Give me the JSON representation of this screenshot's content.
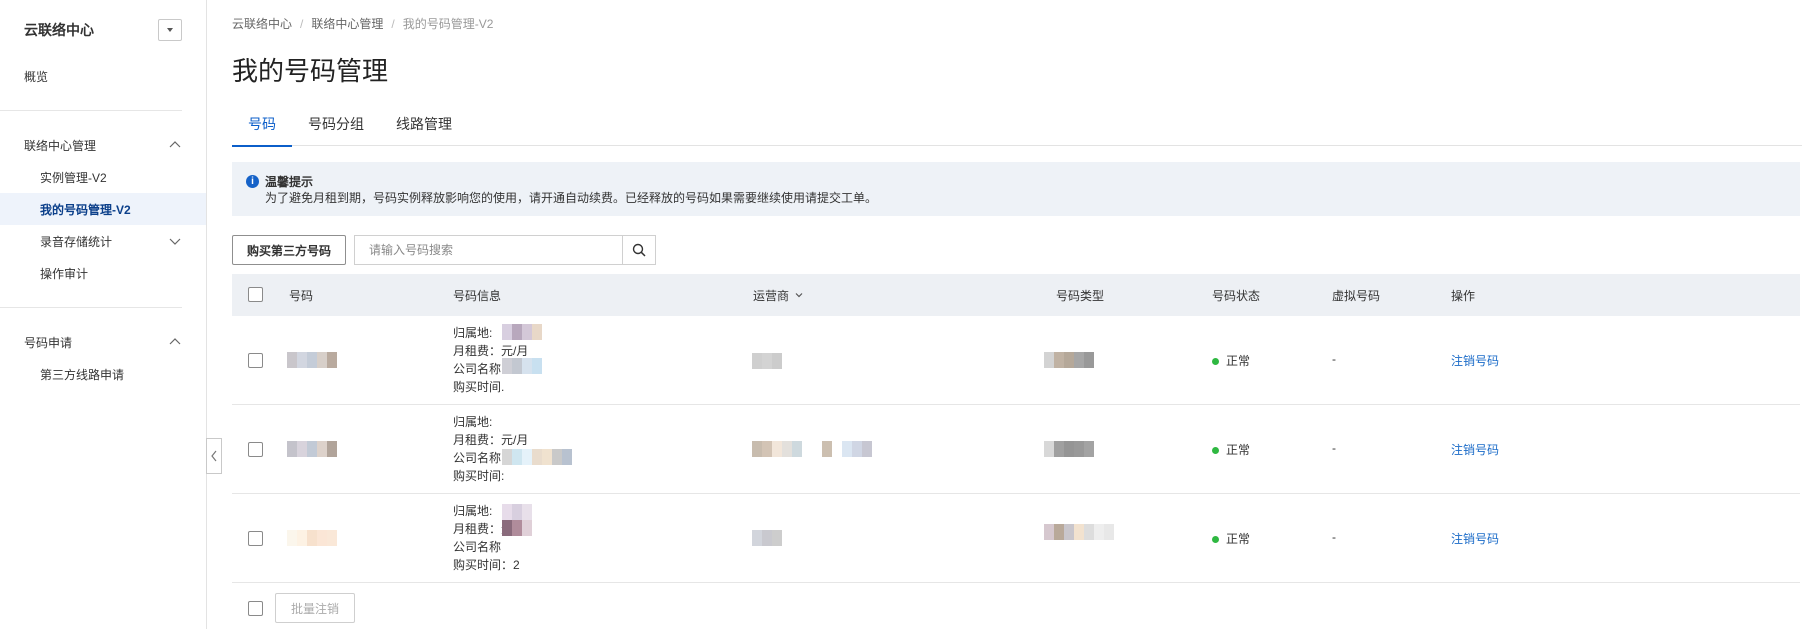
{
  "sidebar": {
    "title": "云联络中心",
    "overview": "概览",
    "groups": [
      {
        "label": "联络中心管理",
        "items": [
          "实例管理-V2",
          "我的号码管理-V2",
          "录音存储统计",
          "操作审计"
        ]
      },
      {
        "label": "号码申请",
        "items": [
          "第三方线路申请"
        ]
      }
    ],
    "active_item": "我的号码管理-V2"
  },
  "breadcrumb": [
    "云联络中心",
    "联络中心管理",
    "我的号码管理-V2"
  ],
  "page_title": "我的号码管理",
  "tabs": [
    "号码",
    "号码分组",
    "线路管理"
  ],
  "active_tab": "号码",
  "notice": {
    "title": "温馨提示",
    "body": "为了避免月租到期，号码实例释放影响您的使用，请开通自动续费。已经释放的号码如果需要继续使用请提交工单。"
  },
  "toolbar": {
    "buy_button": "购买第三方号码",
    "search_placeholder": "请输入号码搜索"
  },
  "table": {
    "headers": [
      "号码",
      "号码信息",
      "运营商",
      "号码类型",
      "号码状态",
      "虚拟号码",
      "操作"
    ],
    "rows": [
      {
        "info": [
          "归属地:",
          "月租费：元/月",
          "公司名称:",
          "购买时间."
        ],
        "status": "正常",
        "virtual": "-",
        "action": "注销号码"
      },
      {
        "info": [
          "归属地:",
          "月租费：元/月",
          "公司名称:",
          "购买时间:"
        ],
        "status": "正常",
        "virtual": "-",
        "action": "注销号码"
      },
      {
        "info": [
          "归属地:",
          "月租费：元/月",
          "公司名称",
          "购买时间：2"
        ],
        "status": "正常",
        "virtual": "-",
        "action": "注销号码"
      }
    ]
  },
  "footer": {
    "batch_button": "批量注销"
  },
  "colors": {
    "accent": "#0b5ec9",
    "status_ok": "#2fb841",
    "link": "#1a6bc8"
  }
}
